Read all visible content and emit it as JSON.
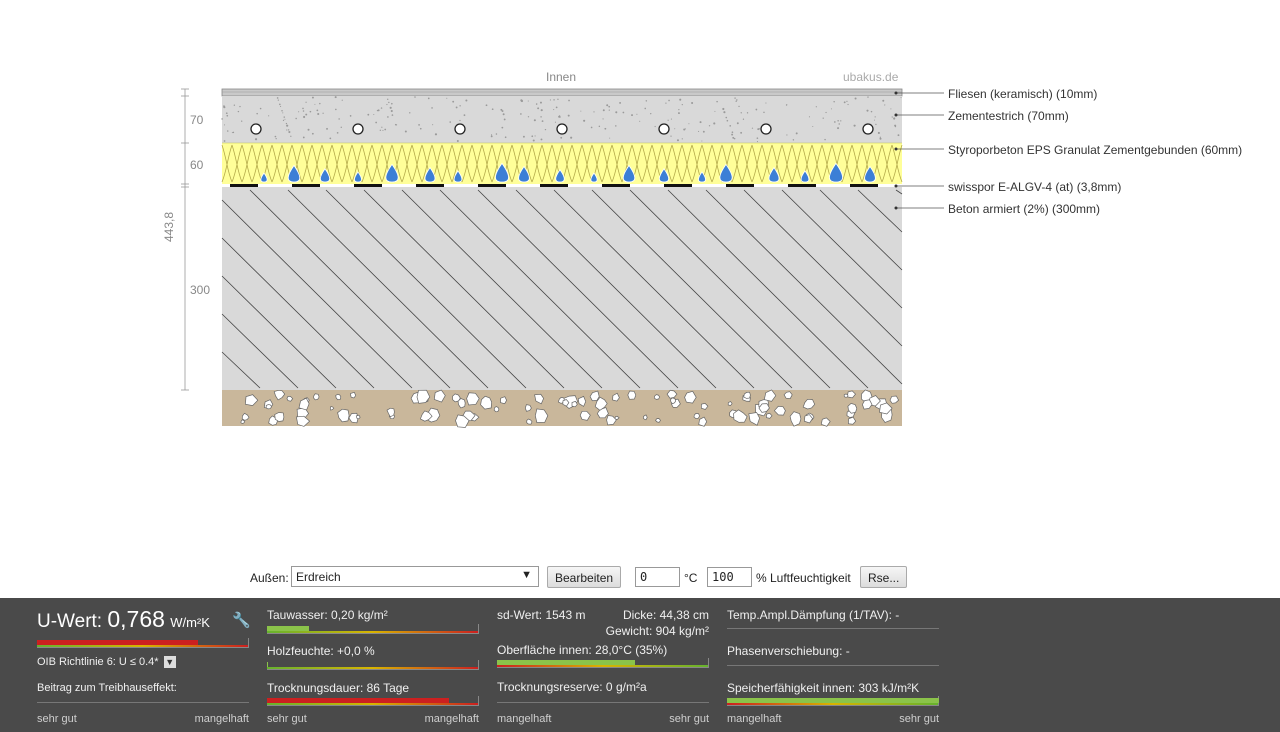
{
  "diagram": {
    "top_label": "Innen",
    "watermark": "ubakus.de",
    "dim_total": "443,8",
    "dims": [
      "70",
      "60",
      "300"
    ],
    "layers": [
      "Fliesen (keramisch) (10mm)",
      "Zementestrich (70mm)",
      "Styroporbeton EPS Granulat Zementgebunden (60mm)",
      "swisspor E-ALGV-4 (at) (3,8mm)",
      "Beton armiert (2%) (300mm)"
    ]
  },
  "controls": {
    "outside_label": "Außen:",
    "outside_value": "Erdreich",
    "edit_button": "Bearbeiten",
    "temp_value": "0",
    "temp_unit": "°C",
    "humidity_value": "100",
    "humidity_label": "% Luftfeuchtigkeit",
    "rse_button": "Rse..."
  },
  "panel": {
    "u_label": "U-Wert:",
    "u_value": "0,768",
    "u_unit": "W/m²K",
    "u_bar_fraction": 0.76,
    "oib_label": "OIB Richtlinie 6: U ≤ 0.4*",
    "greenhouse_label": "Beitrag zum Treibhauseffekt:",
    "col1_left": "sehr gut",
    "col1_right": "mangelhaft",
    "tauwasser": "Tauwasser: 0,20 kg/m²",
    "tauwasser_fraction": 0.2,
    "holzfeuchte": "Holzfeuchte: +0,0 %",
    "holzfeuchte_fraction": 0.0,
    "trocknungsdauer": "Trocknungsdauer: 86 Tage",
    "trocknungsdauer_fraction": 0.86,
    "col2_left": "sehr gut",
    "col2_right": "mangelhaft",
    "sd_wert": "sd-Wert: 1543 m",
    "dicke": "Dicke: 44,38 cm",
    "gewicht": "Gewicht: 904 kg/m²",
    "oberflaeche": "Oberfläche innen: 28,0°C (35%)",
    "oberflaeche_fraction": 0.65,
    "trocknungsreserve": "Trocknungsreserve: 0 g/m²a",
    "trocknungsreserve_fraction": 0.0,
    "col3_left": "mangelhaft",
    "col3_right": "sehr gut",
    "temp_ampl": "Temp.Ampl.Dämpfung (1/TAV): -",
    "phasen": "Phasenverschiebung: -",
    "speicher": "Speicherfähigkeit innen: 303 kJ/m²K",
    "speicher_fraction": 1.0,
    "col4_left": "mangelhaft",
    "col4_right": "sehr gut",
    "colors": {
      "red": "#cc2020",
      "green": "#8bc34a",
      "yellow": "#ffff99",
      "water": "#3c7fd6"
    }
  }
}
